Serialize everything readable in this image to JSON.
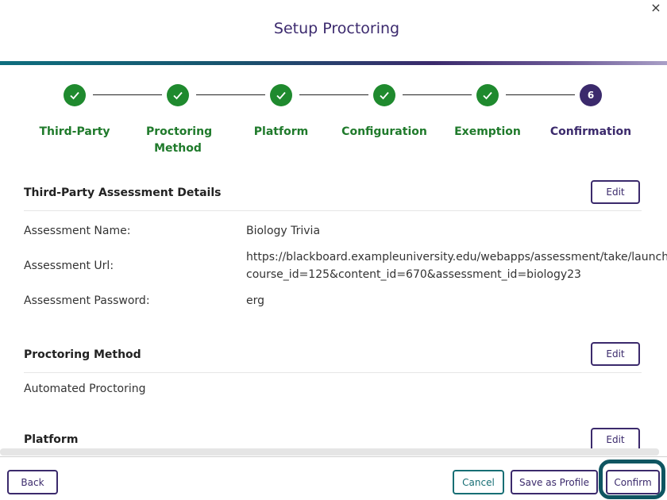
{
  "dialog": {
    "title": "Setup Proctoring",
    "close_label": "×"
  },
  "stepper": {
    "steps": [
      {
        "label": "Third-Party",
        "status": "complete"
      },
      {
        "label": "Proctoring Method",
        "status": "complete"
      },
      {
        "label": "Platform",
        "status": "complete"
      },
      {
        "label": "Configuration",
        "status": "complete"
      },
      {
        "label": "Exemption",
        "status": "complete"
      },
      {
        "label": "Confirmation",
        "status": "current",
        "number": "6"
      }
    ]
  },
  "sections": {
    "assessment": {
      "title": "Third-Party Assessment Details",
      "edit_label": "Edit",
      "fields": [
        {
          "label": "Assessment Name:",
          "value": "Biology Trivia"
        },
        {
          "label": "Assessment Url:",
          "value_line1": "https://blackboard.exampleuniversity.edu/webapps/assessment/take/launch.jsp?",
          "value_line2": "course_id=125&content_id=670&assessment_id=biology23"
        },
        {
          "label": "Assessment Password:",
          "value": "erg"
        }
      ]
    },
    "method": {
      "title": "Proctoring Method",
      "edit_label": "Edit",
      "value": "Automated Proctoring"
    },
    "platform": {
      "title": "Platform",
      "edit_label": "Edit"
    }
  },
  "footer": {
    "back_label": "Back",
    "cancel_label": "Cancel",
    "save_profile_label": "Save as Profile",
    "confirm_label": "Confirm"
  },
  "colors": {
    "complete": "#1f8a2e",
    "current": "#3b2a6c",
    "accent_teal": "#176e74"
  }
}
